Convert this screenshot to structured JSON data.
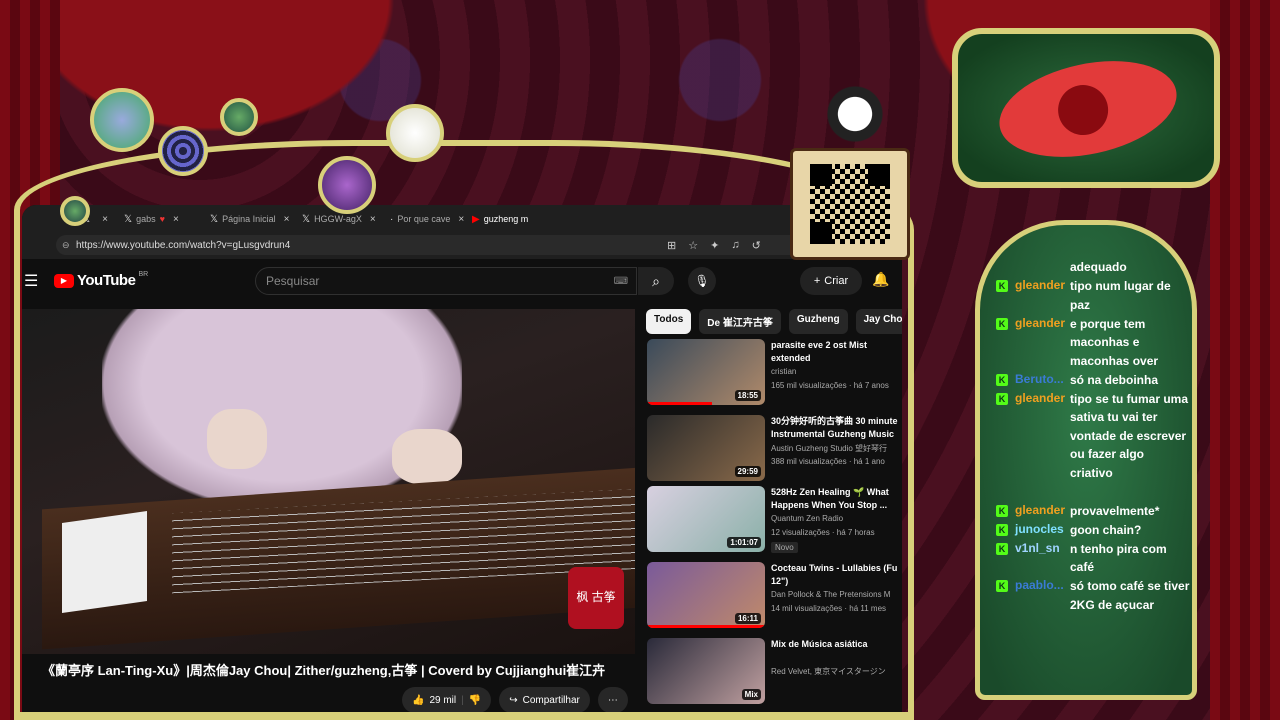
{
  "browser": {
    "tabs": [
      {
        "label": "",
        "icon": "x-icon"
      },
      {
        "label": "gabs",
        "icon": "x-icon"
      },
      {
        "label": "Página Inicial",
        "icon": "x-icon"
      },
      {
        "label": "HGGW-agX",
        "icon": "x-icon"
      },
      {
        "label": "Por que cave",
        "icon": "generic-icon"
      },
      {
        "label": "guzheng m",
        "icon": "youtube-icon"
      }
    ],
    "url": "https://www.youtube.com/watch?v=gLusgvdrun4"
  },
  "youtube": {
    "logo": "YouTube",
    "region": "BR",
    "search_placeholder": "Pesquisar",
    "create_label": "Criar",
    "video": {
      "title": "《蘭亭序 Lan-Ting-Xu》|周杰倫Jay Chou| Zither/guzheng,古筝 | Coverd by Cujjianghui崔江卉",
      "likes": "29 mil",
      "share_label": "Compartilhar",
      "watermark": "枫 古筝"
    },
    "chips": [
      "Todos",
      "De 崔江卉古筝",
      "Guzheng",
      "Jay Chou"
    ],
    "recommendations": [
      {
        "title": "parasite eve 2 ost Mist extended",
        "channel": "cristian",
        "meta": "165 mil visualizações · há 7 anos",
        "duration": "18:55",
        "progress": 0.55,
        "badge": ""
      },
      {
        "title": "30分钟好听的古筝曲 30 minute Instrumental Guzheng Music",
        "channel": "Austin Guzheng Studio 望好琴行",
        "meta": "388 mil visualizações · há 1 ano",
        "duration": "29:59",
        "progress": 0,
        "badge": ""
      },
      {
        "title": "528Hz Zen Healing 🌱 What Happens When You Stop ...",
        "channel": "Quantum Zen Radio",
        "meta": "12 visualizações · há 7 horas",
        "duration": "1:01:07",
        "progress": 0,
        "badge": "Novo"
      },
      {
        "title": "Cocteau Twins - Lullabies (Fu 12\")",
        "channel": "Dan Pollock & The Pretensions M",
        "meta": "14 mil visualizações · há 11 mes",
        "duration": "16:11",
        "progress": 1,
        "badge": ""
      },
      {
        "title": "Mix de Música asiática",
        "channel": "Red Velvet, 東京マイスタージン",
        "meta": "",
        "duration": "Mix",
        "progress": 0,
        "badge": ""
      }
    ]
  },
  "chat": {
    "messages": [
      {
        "user": "",
        "user_color": "#53fc18",
        "text": "adequado"
      },
      {
        "user": "gleander",
        "user_color": "#f0a020",
        "text": "tipo num lugar de paz"
      },
      {
        "user": "gleander",
        "user_color": "#f0a020",
        "text": "e porque tem maconhas e maconhas over"
      },
      {
        "user": "Beruto...",
        "user_color": "#3a7bd5",
        "text": "só na deboinha"
      },
      {
        "user": "gleander",
        "user_color": "#f0a020",
        "text": "tipo se tu fumar uma sativa tu vai ter vontade de escrever ou fazer algo criativo"
      },
      {
        "user": "gleander",
        "user_color": "#f0a020",
        "text": "provavelmente*"
      },
      {
        "user": "junocles",
        "user_color": "#7fe0ff",
        "text": "goon chain?"
      },
      {
        "user": "v1nl_sn",
        "user_color": "#9fd4ff",
        "text": "n tenho pira com café"
      },
      {
        "user": "paablo...",
        "user_color": "#3a7bd5",
        "text": "só tomo café se tiver 2KG de açucar"
      }
    ]
  },
  "colors": {
    "frame_gold": "#d8d07a",
    "yt_red": "#ff0000",
    "kick_green": "#53fc18"
  }
}
